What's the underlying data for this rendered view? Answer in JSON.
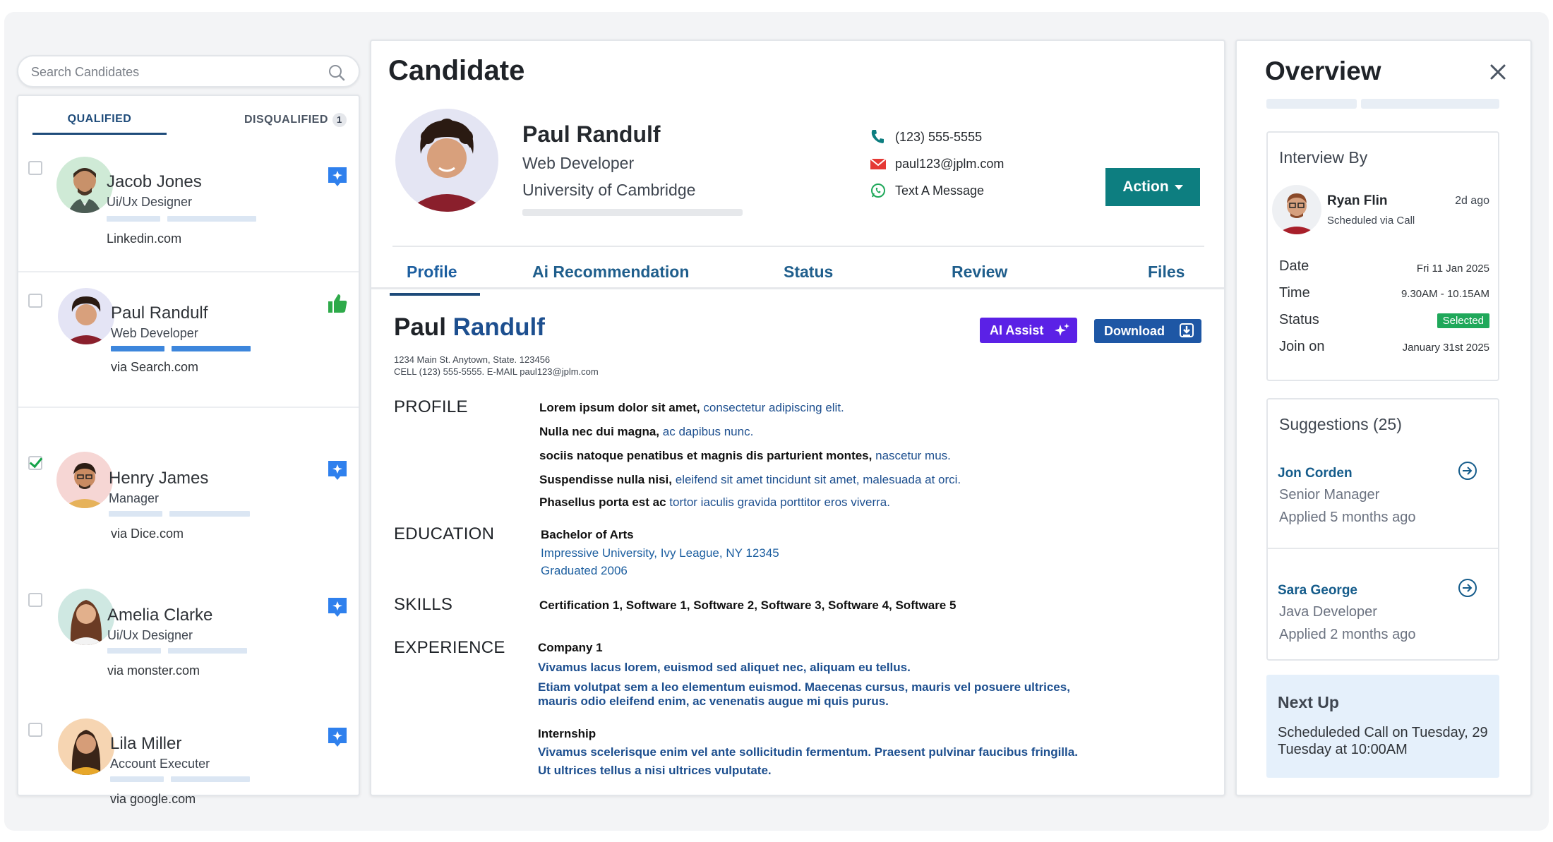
{
  "search": {
    "placeholder": "Search Candidates"
  },
  "tabs": {
    "qualified": "QUALIFIED",
    "disqualified": "DISQUALIFIED",
    "disqualified_count": "1"
  },
  "candidates": [
    {
      "name": "Jacob Jones",
      "role": "Ui/Ux Designer",
      "source": "Linkedin.com",
      "checked": false,
      "badge": "ai-star"
    },
    {
      "name": "Paul Randulf",
      "role": "Web Developer",
      "source": "via Search.com",
      "checked": false,
      "badge": "thumbs-up"
    },
    {
      "name": "Henry James",
      "role": "Manager",
      "source": "via Dice.com",
      "checked": true,
      "badge": "ai-star"
    },
    {
      "name": "Amelia Clarke",
      "role": "Ui/Ux Designer",
      "source": "via monster.com",
      "checked": false,
      "badge": "ai-star"
    },
    {
      "name": "Lila Miller",
      "role": "Account Executer",
      "source": "via google.com",
      "checked": false,
      "badge": "ai-star"
    }
  ],
  "candidate": {
    "title": "Candidate",
    "name": "Paul Randulf",
    "role": "Web Developer",
    "school": "University of Cambridge",
    "phone": "(123) 555-5555",
    "email": "paul123@jplm.com",
    "message": "Text A Message",
    "action_label": "Action"
  },
  "detail_tabs": [
    "Profile",
    "Ai Recommendation",
    "Status",
    "Review",
    "Files"
  ],
  "resume": {
    "first_name": "Paul",
    "last_name": "Randulf",
    "ai_assist": "AI Assist",
    "download": "Download",
    "address": "1234 Main St. Anytown, State. 123456",
    "contact_line": "CELL (123) 555-5555. E-MAIL  paul123@jplm.com",
    "sections": {
      "profile": "PROFILE",
      "education": "EDUCATION",
      "skills": "SKILLS",
      "experience": "EXPERIENCE"
    },
    "profile_lines": [
      {
        "bold": "Lorem ipsum dolor sit amet,",
        "rest": "consectetur adipiscing elit."
      },
      {
        "bold": "Nulla nec dui magna,",
        "rest": "ac dapibus nunc."
      },
      {
        "bold": "sociis natoque penatibus et magnis dis parturient montes,",
        "rest": "nascetur mus."
      },
      {
        "bold": "Suspendisse nulla nisi,",
        "rest": "eleifend sit amet tincidunt sit amet, malesuada at orci."
      },
      {
        "bold": "Phasellus porta est ac",
        "rest": "tortor iaculis gravida porttitor eros viverra."
      }
    ],
    "education": {
      "degree": "Bachelor of Arts",
      "school": "Impressive University, Ivy League, NY 12345",
      "graduated": "Graduated 2006"
    },
    "skills": "Certification 1, Software 1, Software 2, Software 3,  Software 4, Software 5",
    "experience": {
      "company": "Company 1",
      "line1": "Vivamus lacus lorem, euismod sed aliquet nec, aliquam eu tellus.",
      "line2": "Etiam volutpat sem a leo elementum euismod. Maecenas cursus, mauris vel posuere ultrices,",
      "line3": "mauris odio eleifend enim, ac venenatis augue mi quis purus.",
      "internship": "Internship",
      "line4": "Vivamus scelerisque enim vel ante sollicitudin fermentum. Praesent pulvinar faucibus fringilla.",
      "line5": "Ut ultrices tellus a nisi ultrices vulputate."
    }
  },
  "overview": {
    "title": "Overview",
    "interview": {
      "heading": "Interview By",
      "name": "Ryan Flin",
      "sub": "Scheduled via Call",
      "ago": "2d ago",
      "date_label": "Date",
      "date": "Fri 11 Jan 2025",
      "time_label": "Time",
      "time": "9.30AM - 10.15AM",
      "status_label": "Status",
      "status": "Selected",
      "join_label": "Join on",
      "join": "January 31st 2025"
    },
    "suggestions": {
      "heading": "Suggestions (25)",
      "items": [
        {
          "name": "Jon Corden",
          "role": "Senior Manager",
          "applied": "Applied 5 months ago"
        },
        {
          "name": "Sara George",
          "role": "Java Developer",
          "applied": "Applied 2 months ago"
        }
      ]
    },
    "next_up": {
      "heading": "Next Up",
      "text": "Scheduleded Call on Tuesday, 29 Tuesday at 10:00AM"
    }
  },
  "colors": {
    "accent": "#0d7e80",
    "brand_blue": "#1e4b7a",
    "ai_purple": "#5b21e6",
    "selected_green": "#1fa85a",
    "badge_blue": "#2f80ed"
  }
}
